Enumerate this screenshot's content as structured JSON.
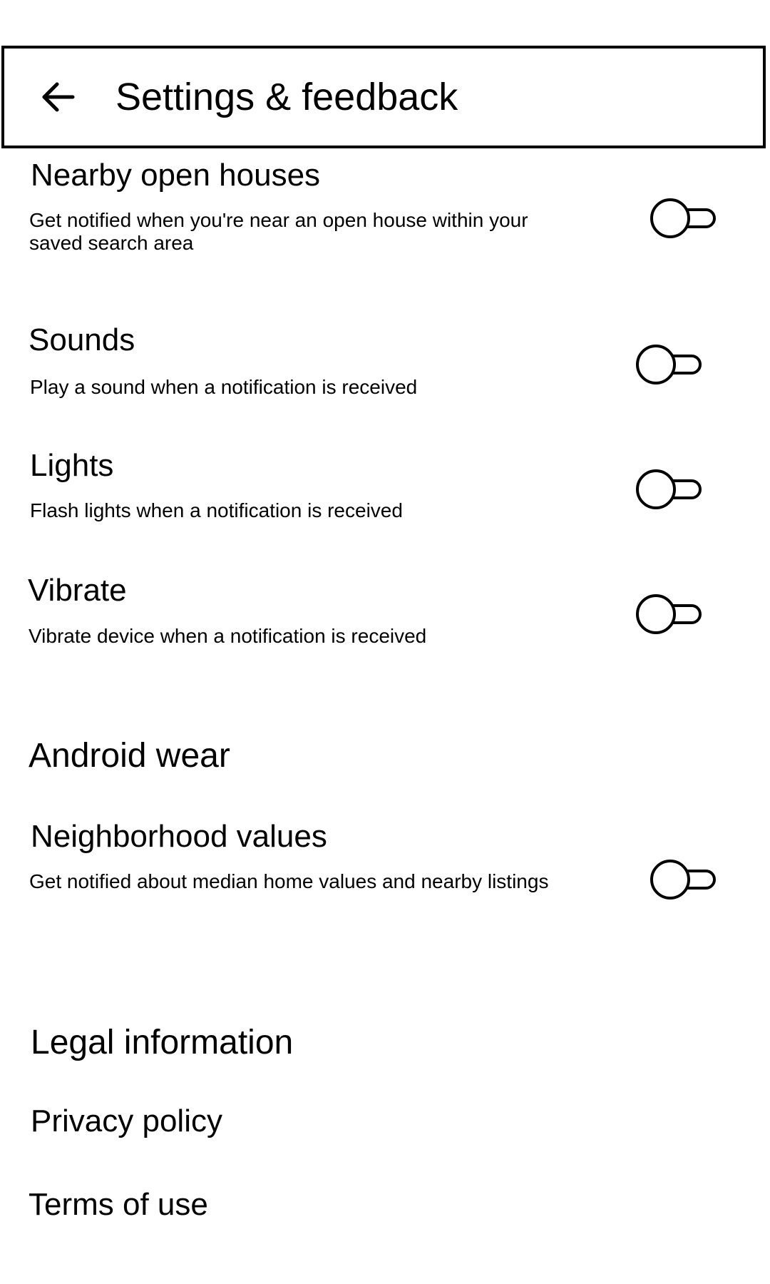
{
  "header": {
    "title": "Settings & feedback",
    "back_icon": "arrow-back-icon"
  },
  "notifications": [
    {
      "title": "Nearby open houses",
      "subtitle_lines": [
        "Get notified when you're near an open house within your",
        "saved search area"
      ],
      "enabled": false
    },
    {
      "title": "Sounds",
      "subtitle_lines": [
        "Play a sound when a notification is received"
      ],
      "enabled": false
    },
    {
      "title": "Lights",
      "subtitle_lines": [
        "Flash lights when a notification is received"
      ],
      "enabled": false
    },
    {
      "title": "Vibrate",
      "subtitle_lines": [
        "Vibrate device when a notification is received"
      ],
      "enabled": false
    }
  ],
  "android_wear": {
    "header": "Android wear",
    "items": [
      {
        "title": "Neighborhood values",
        "subtitle_lines": [
          "Get notified about median home values and nearby listings"
        ],
        "enabled": false
      }
    ]
  },
  "legal": {
    "header": "Legal information",
    "links": [
      {
        "label": "Privacy policy"
      },
      {
        "label": "Terms of use"
      }
    ]
  },
  "colors": {
    "foreground": "#000000",
    "background": "#ffffff"
  }
}
